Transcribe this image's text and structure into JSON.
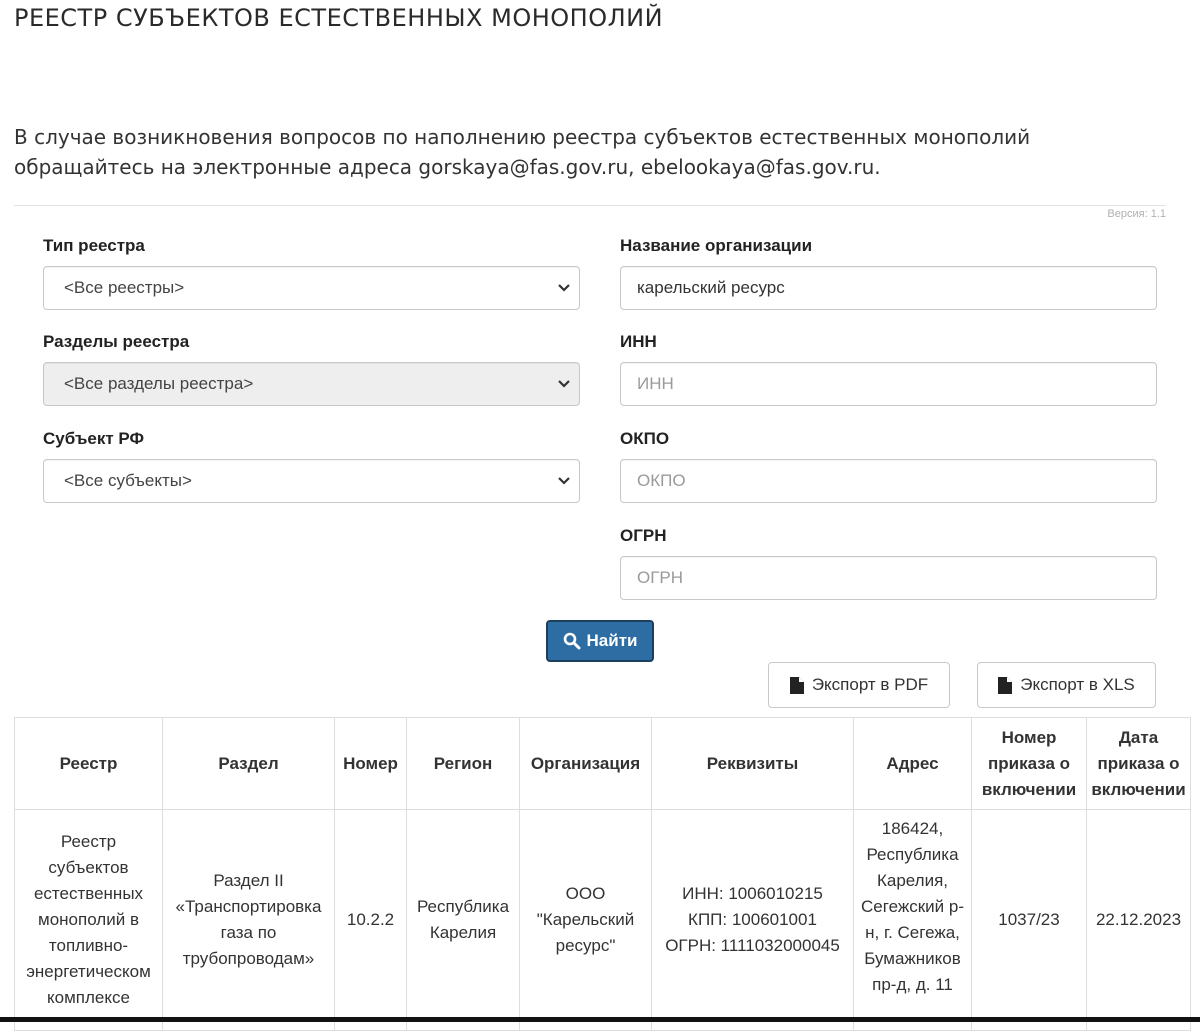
{
  "page": {
    "title": "РЕЕСТР СУБЪЕКТОВ ЕСТЕСТВЕННЫХ МОНОПОЛИЙ",
    "notice": "В случае возникновения вопросов по наполнению реестра субъектов естественных монополий обращайтесь на электронные адреса gorskaya@fas.gov.ru, ebelookaya@fas.gov.ru.",
    "version": "Версия: 1.1"
  },
  "filters": {
    "registry_type": {
      "label": "Тип реестра",
      "value": "<Все реестры>"
    },
    "registry_sections": {
      "label": "Разделы реестра",
      "value": "<Все разделы реестра>"
    },
    "subject": {
      "label": "Субъект РФ",
      "value": "<Все субъекты>"
    },
    "org_name": {
      "label": "Название организации",
      "value": "карельский ресурс"
    },
    "inn": {
      "label": "ИНН",
      "placeholder": "ИНН"
    },
    "okpo": {
      "label": "ОКПО",
      "placeholder": "ОКПО"
    },
    "ogrn": {
      "label": "ОГРН",
      "placeholder": "ОГРН"
    }
  },
  "actions": {
    "search": "Найти",
    "export_pdf": "Экспорт в PDF",
    "export_xls": "Экспорт в XLS"
  },
  "table": {
    "headers": [
      "Реестр",
      "Раздел",
      "Номер",
      "Регион",
      "Организация",
      "Реквизиты",
      "Адрес",
      "Номер приказа о включении",
      "Дата приказа о включении"
    ],
    "rows": [
      {
        "registry": "Реестр субъектов естественных монополий в топливно-энергетическом комплексе",
        "section": "Раздел II «Транспортировка газа по трубопроводам»",
        "number": "10.2.2",
        "region": "Республика Карелия",
        "organization": "ООО \"Карельский ресурс\"",
        "requisites_inn": "ИНН: 1006010215",
        "requisites_kpp": "КПП: 100601001",
        "requisites_ogrn": "ОГРН: 1111032000045",
        "address": "186424, Республика Карелия, Сегежский р-н, г. Сегежа, Бумажников пр-д, д. 11",
        "order_number": "1037/23",
        "order_date": "22.12.2023"
      }
    ]
  },
  "colors": {
    "primary_button": "#2e6da4",
    "border": "#dddddd",
    "disabled_bg": "#eeeeee"
  },
  "icons": [
    "search-icon",
    "file-icon",
    "chevron-down-icon"
  ]
}
